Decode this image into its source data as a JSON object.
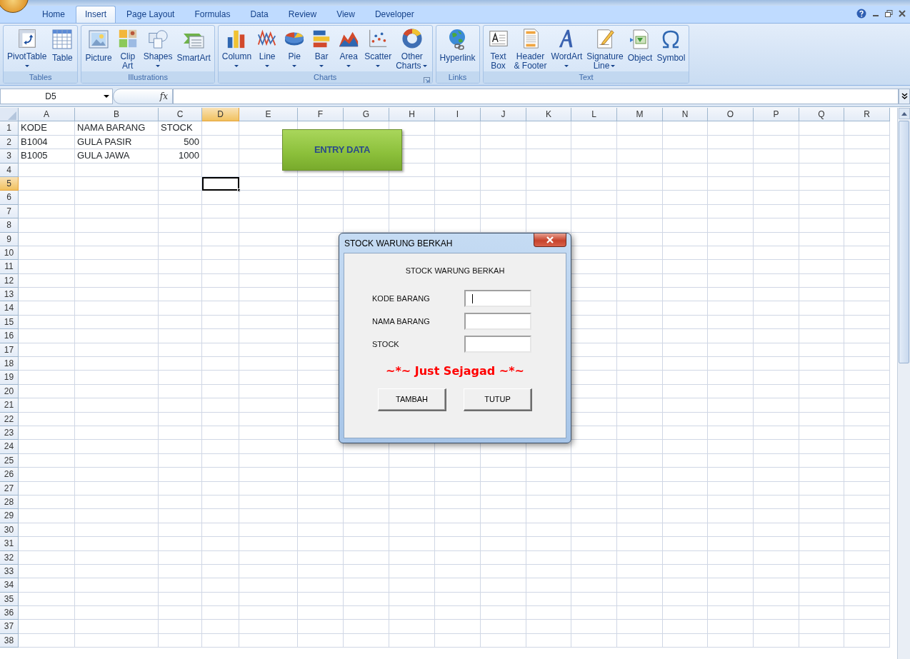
{
  "tabs": [
    {
      "label": "Home",
      "selected": false
    },
    {
      "label": "Insert",
      "selected": true
    },
    {
      "label": "Page Layout",
      "selected": false
    },
    {
      "label": "Formulas",
      "selected": false
    },
    {
      "label": "Data",
      "selected": false
    },
    {
      "label": "Review",
      "selected": false
    },
    {
      "label": "View",
      "selected": false
    },
    {
      "label": "Developer",
      "selected": false
    }
  ],
  "ribbon": {
    "groups": [
      {
        "label": "Tables",
        "launcher": false,
        "items": [
          {
            "label_lines": [
              "PivotTable"
            ],
            "dropdown": true
          },
          {
            "label_lines": [
              "Table"
            ],
            "dropdown": false
          }
        ]
      },
      {
        "label": "Illustrations",
        "launcher": false,
        "items": [
          {
            "label_lines": [
              "Picture"
            ],
            "dropdown": false
          },
          {
            "label_lines": [
              "Clip",
              "Art"
            ],
            "dropdown": false
          },
          {
            "label_lines": [
              "Shapes"
            ],
            "dropdown": true
          },
          {
            "label_lines": [
              "SmartArt"
            ],
            "dropdown": false
          }
        ]
      },
      {
        "label": "Charts",
        "launcher": true,
        "items": [
          {
            "label_lines": [
              "Column"
            ],
            "dropdown": true
          },
          {
            "label_lines": [
              "Line"
            ],
            "dropdown": true
          },
          {
            "label_lines": [
              "Pie"
            ],
            "dropdown": true
          },
          {
            "label_lines": [
              "Bar"
            ],
            "dropdown": true
          },
          {
            "label_lines": [
              "Area"
            ],
            "dropdown": true
          },
          {
            "label_lines": [
              "Scatter"
            ],
            "dropdown": true
          },
          {
            "label_lines": [
              "Other",
              "Charts"
            ],
            "dropdown": true
          }
        ]
      },
      {
        "label": "Links",
        "launcher": false,
        "items": [
          {
            "label_lines": [
              "Hyperlink"
            ],
            "dropdown": false
          }
        ]
      },
      {
        "label": "Text",
        "launcher": false,
        "items": [
          {
            "label_lines": [
              "Text",
              "Box"
            ],
            "dropdown": false
          },
          {
            "label_lines": [
              "Header",
              "& Footer"
            ],
            "dropdown": false
          },
          {
            "label_lines": [
              "WordArt"
            ],
            "dropdown": true
          },
          {
            "label_lines": [
              "Signature",
              "Line"
            ],
            "dropdown": true
          },
          {
            "label_lines": [
              "Object"
            ],
            "dropdown": false
          },
          {
            "label_lines": [
              "Symbol"
            ],
            "dropdown": false
          }
        ]
      }
    ]
  },
  "formula_bar": {
    "name_box": "D5",
    "function_label": "fx"
  },
  "sheet": {
    "columns": [
      {
        "label": "A",
        "selected": false
      },
      {
        "label": "B",
        "selected": false
      },
      {
        "label": "C",
        "selected": false
      },
      {
        "label": "D",
        "selected": true
      },
      {
        "label": "E",
        "selected": false
      },
      {
        "label": "F",
        "selected": false
      },
      {
        "label": "G",
        "selected": false
      },
      {
        "label": "H",
        "selected": false
      },
      {
        "label": "I",
        "selected": false
      },
      {
        "label": "J",
        "selected": false
      },
      {
        "label": "K",
        "selected": false
      },
      {
        "label": "L",
        "selected": false
      },
      {
        "label": "M",
        "selected": false
      },
      {
        "label": "N",
        "selected": false
      },
      {
        "label": "O",
        "selected": false
      },
      {
        "label": "P",
        "selected": false
      },
      {
        "label": "Q",
        "selected": false
      },
      {
        "label": "R",
        "selected": false
      }
    ],
    "rows": [
      {
        "label": "1",
        "selected": false,
        "cells": [
          {
            "text": "KODE",
            "kind": "text"
          },
          {
            "text": "NAMA BARANG",
            "kind": "text"
          },
          {
            "text": "STOCK",
            "kind": "text"
          }
        ]
      },
      {
        "label": "2",
        "selected": false,
        "cells": [
          {
            "text": "B1004",
            "kind": "text"
          },
          {
            "text": "GULA PASIR",
            "kind": "text"
          },
          {
            "text": "500",
            "kind": "number"
          }
        ]
      },
      {
        "label": "3",
        "selected": false,
        "cells": [
          {
            "text": "B1005",
            "kind": "text"
          },
          {
            "text": "GULA JAWA",
            "kind": "text"
          },
          {
            "text": "1000",
            "kind": "number"
          }
        ]
      },
      {
        "label": "4",
        "selected": false
      },
      {
        "label": "5",
        "selected": true
      },
      {
        "label": "6",
        "selected": false
      },
      {
        "label": "7",
        "selected": false
      },
      {
        "label": "8",
        "selected": false
      },
      {
        "label": "9",
        "selected": false
      },
      {
        "label": "10",
        "selected": false
      },
      {
        "label": "11",
        "selected": false
      },
      {
        "label": "12",
        "selected": false
      },
      {
        "label": "13",
        "selected": false
      },
      {
        "label": "14",
        "selected": false
      },
      {
        "label": "15",
        "selected": false
      },
      {
        "label": "16",
        "selected": false
      },
      {
        "label": "17",
        "selected": false
      },
      {
        "label": "18",
        "selected": false
      },
      {
        "label": "19",
        "selected": false
      },
      {
        "label": "20",
        "selected": false
      },
      {
        "label": "21",
        "selected": false
      },
      {
        "label": "22",
        "selected": false
      },
      {
        "label": "23",
        "selected": false
      },
      {
        "label": "24",
        "selected": false
      },
      {
        "label": "25",
        "selected": false
      },
      {
        "label": "26",
        "selected": false
      },
      {
        "label": "27",
        "selected": false
      },
      {
        "label": "28",
        "selected": false
      },
      {
        "label": "29",
        "selected": false
      },
      {
        "label": "30",
        "selected": false
      },
      {
        "label": "31",
        "selected": false
      },
      {
        "label": "32",
        "selected": false
      },
      {
        "label": "33",
        "selected": false
      },
      {
        "label": "34",
        "selected": false
      },
      {
        "label": "35",
        "selected": false
      },
      {
        "label": "36",
        "selected": false
      },
      {
        "label": "37",
        "selected": false
      },
      {
        "label": "38",
        "selected": false
      }
    ]
  },
  "shape_button": {
    "label": "ENTRY DATA"
  },
  "dialog": {
    "title": "STOCK WARUNG BERKAH",
    "heading": "STOCK WARUNG BERKAH",
    "fields": [
      {
        "label": "KODE BARANG",
        "focused": true
      },
      {
        "label": "NAMA BARANG",
        "focused": false
      },
      {
        "label": "STOCK",
        "focused": false
      }
    ],
    "tagline": "~*~ Just Sejagad ~*~",
    "buttons": [
      "TAMBAH",
      "TUTUP"
    ]
  }
}
